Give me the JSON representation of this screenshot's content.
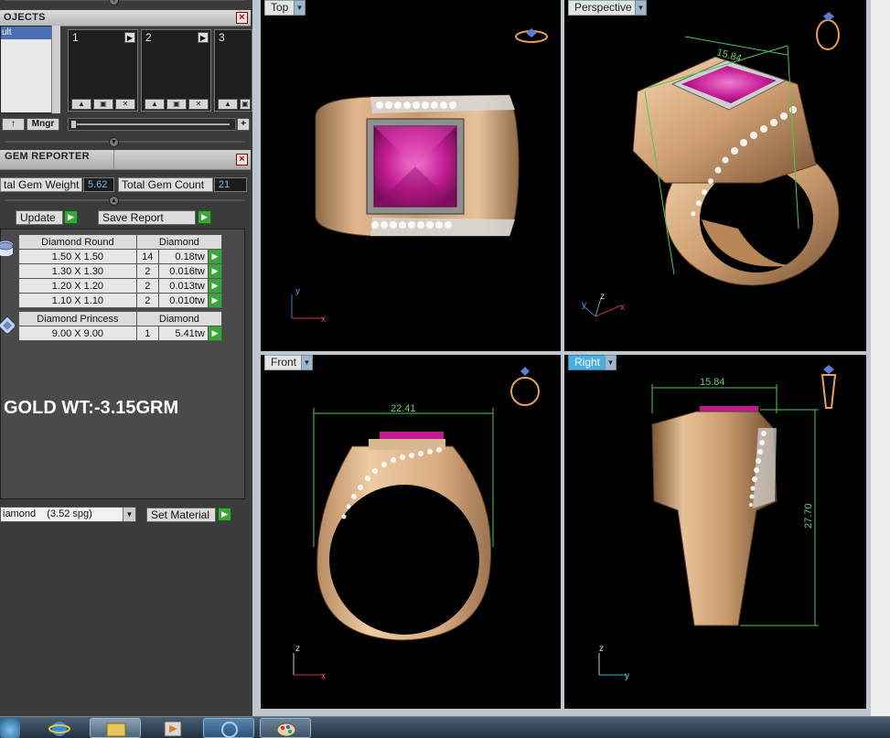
{
  "projects": {
    "panel_title": "OJECTS",
    "list_selected": "ult",
    "slots": [
      "1",
      "2",
      "3"
    ],
    "up_button": "↑",
    "manager_button": "Mngr",
    "add_button": "+"
  },
  "gem_reporter": {
    "title": "GEM REPORTER",
    "total_weight_label": "tal Gem Weight",
    "total_weight_value": "5.62",
    "total_count_label": "Total Gem Count",
    "total_count_value": "21",
    "update_button": "Update",
    "save_report_button": "Save Report",
    "round_table": {
      "headers": [
        "Diamond Round",
        "Diamond"
      ],
      "rows": [
        {
          "size": "1.50 X 1.50",
          "count": "14",
          "weight": "0.18tw"
        },
        {
          "size": "1.30 X 1.30",
          "count": "2",
          "weight": "0.016tw"
        },
        {
          "size": "1.20 X 1.20",
          "count": "2",
          "weight": "0.013tw"
        },
        {
          "size": "1.10 X 1.10",
          "count": "2",
          "weight": "0.010tw"
        }
      ]
    },
    "princess_table": {
      "headers": [
        "Diamond Princess",
        "Diamond"
      ],
      "rows": [
        {
          "size": "9.00 X 9.00",
          "count": "1",
          "weight": "5.41tw"
        }
      ]
    },
    "gold_weight_text": "GOLD WT:-3.15GRM",
    "material_value": "iamond    (3.52 spg)",
    "set_material_button": "Set Material"
  },
  "viewports": {
    "top": {
      "label": "Top",
      "axes": [
        "y",
        "x"
      ]
    },
    "perspective": {
      "label": "Perspective",
      "axes": [
        "y",
        "z",
        "x"
      ],
      "dimension": "15.84"
    },
    "front": {
      "label": "Front",
      "axes": [
        "z",
        "x"
      ],
      "dimension": "22.41"
    },
    "right": {
      "label": "Right",
      "axes": [
        "z",
        "y"
      ],
      "dimension_width": "15.84",
      "dimension_height": "27.70"
    }
  },
  "colors": {
    "gold": "#d9a978",
    "gem": "#c8198a",
    "dimension_line": "#4fc84f",
    "active_label": "#4aaee0",
    "value_text": "#79b4e8"
  }
}
